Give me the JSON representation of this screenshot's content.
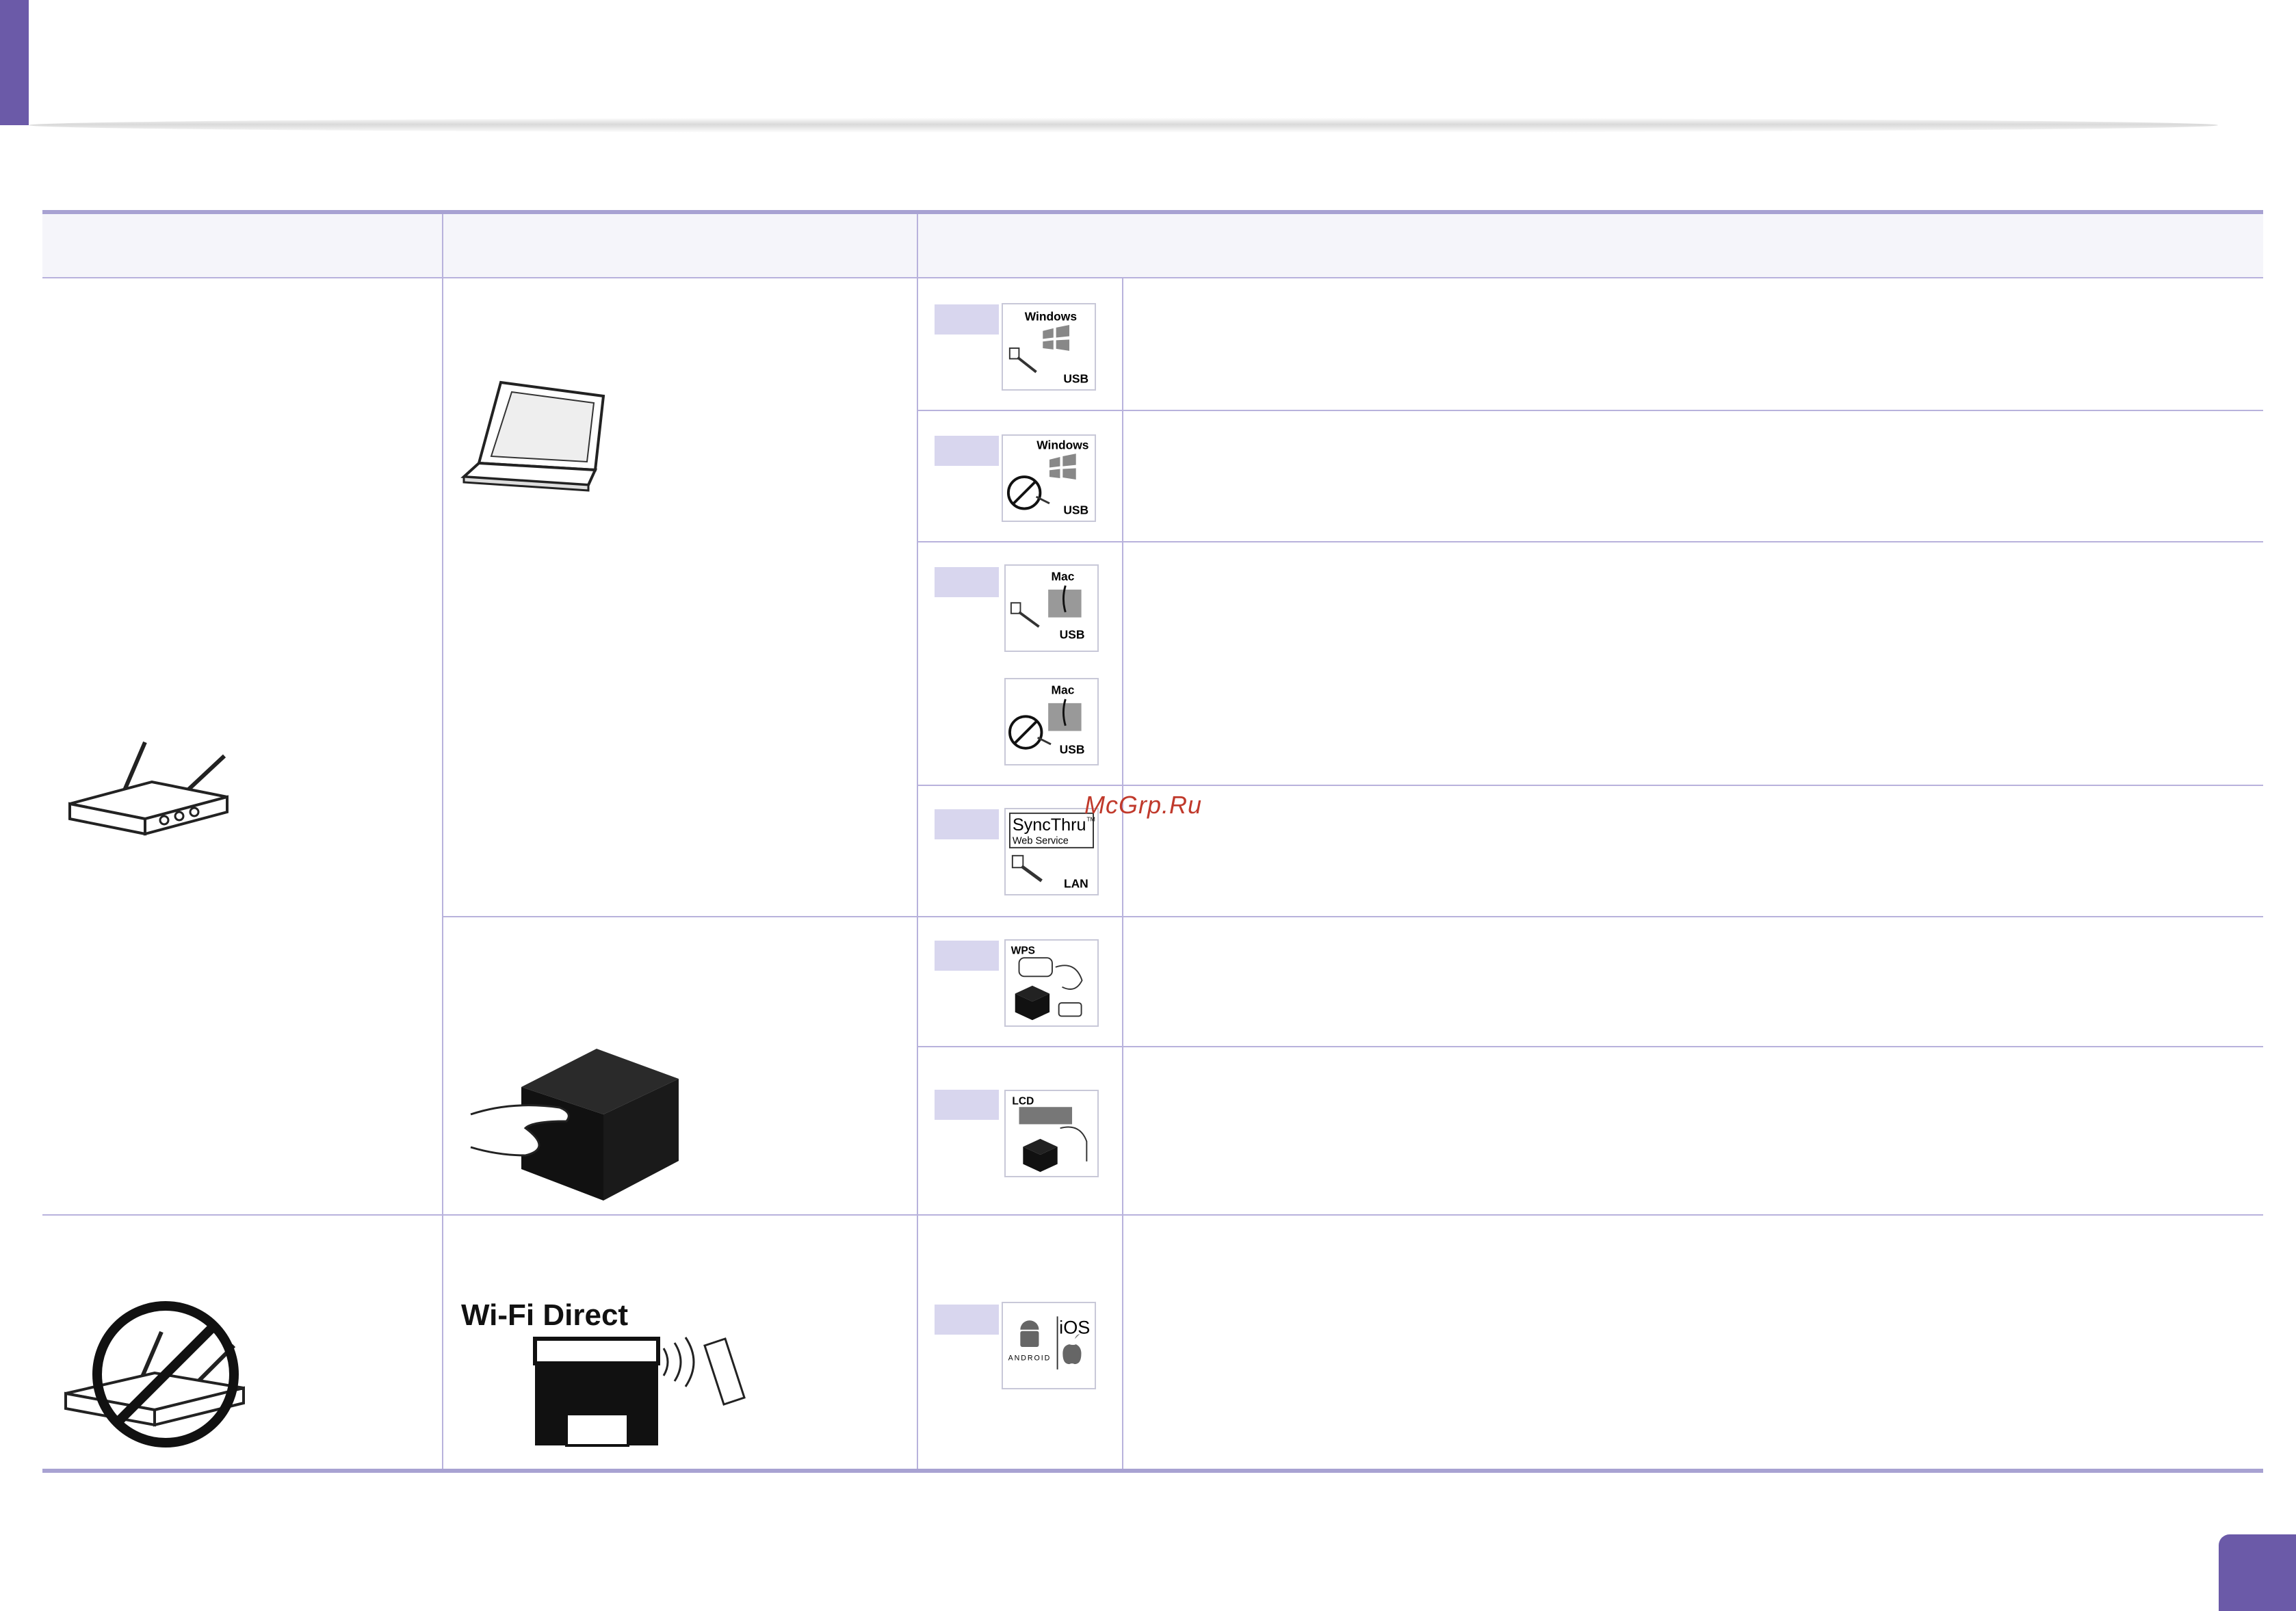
{
  "watermark": "McGrp.Ru",
  "badges": {
    "windows_usb": {
      "title": "Windows",
      "port": "USB"
    },
    "windows_nousb": {
      "title": "Windows",
      "port": "USB"
    },
    "mac_usb": {
      "title": "Mac",
      "port": "USB"
    },
    "mac_nousb": {
      "title": "Mac",
      "port": "USB"
    },
    "syncthru": {
      "title": "SyncThru",
      "tm": "TM",
      "subtitle": "Web Service",
      "port": "LAN"
    },
    "wps": {
      "title": "WPS"
    },
    "lcd": {
      "title": "LCD"
    },
    "mobile": {
      "android": "ANDROID",
      "ios": "iOS"
    }
  },
  "illustrations": {
    "wifi_direct_label": "Wi-Fi Direct"
  },
  "colors": {
    "accent": "#6b5aa8",
    "table_rule": "#a8a2d2",
    "grid_line": "#b8b2dc",
    "tag_fill": "#d8d6ee",
    "watermark": "#c0392b"
  }
}
